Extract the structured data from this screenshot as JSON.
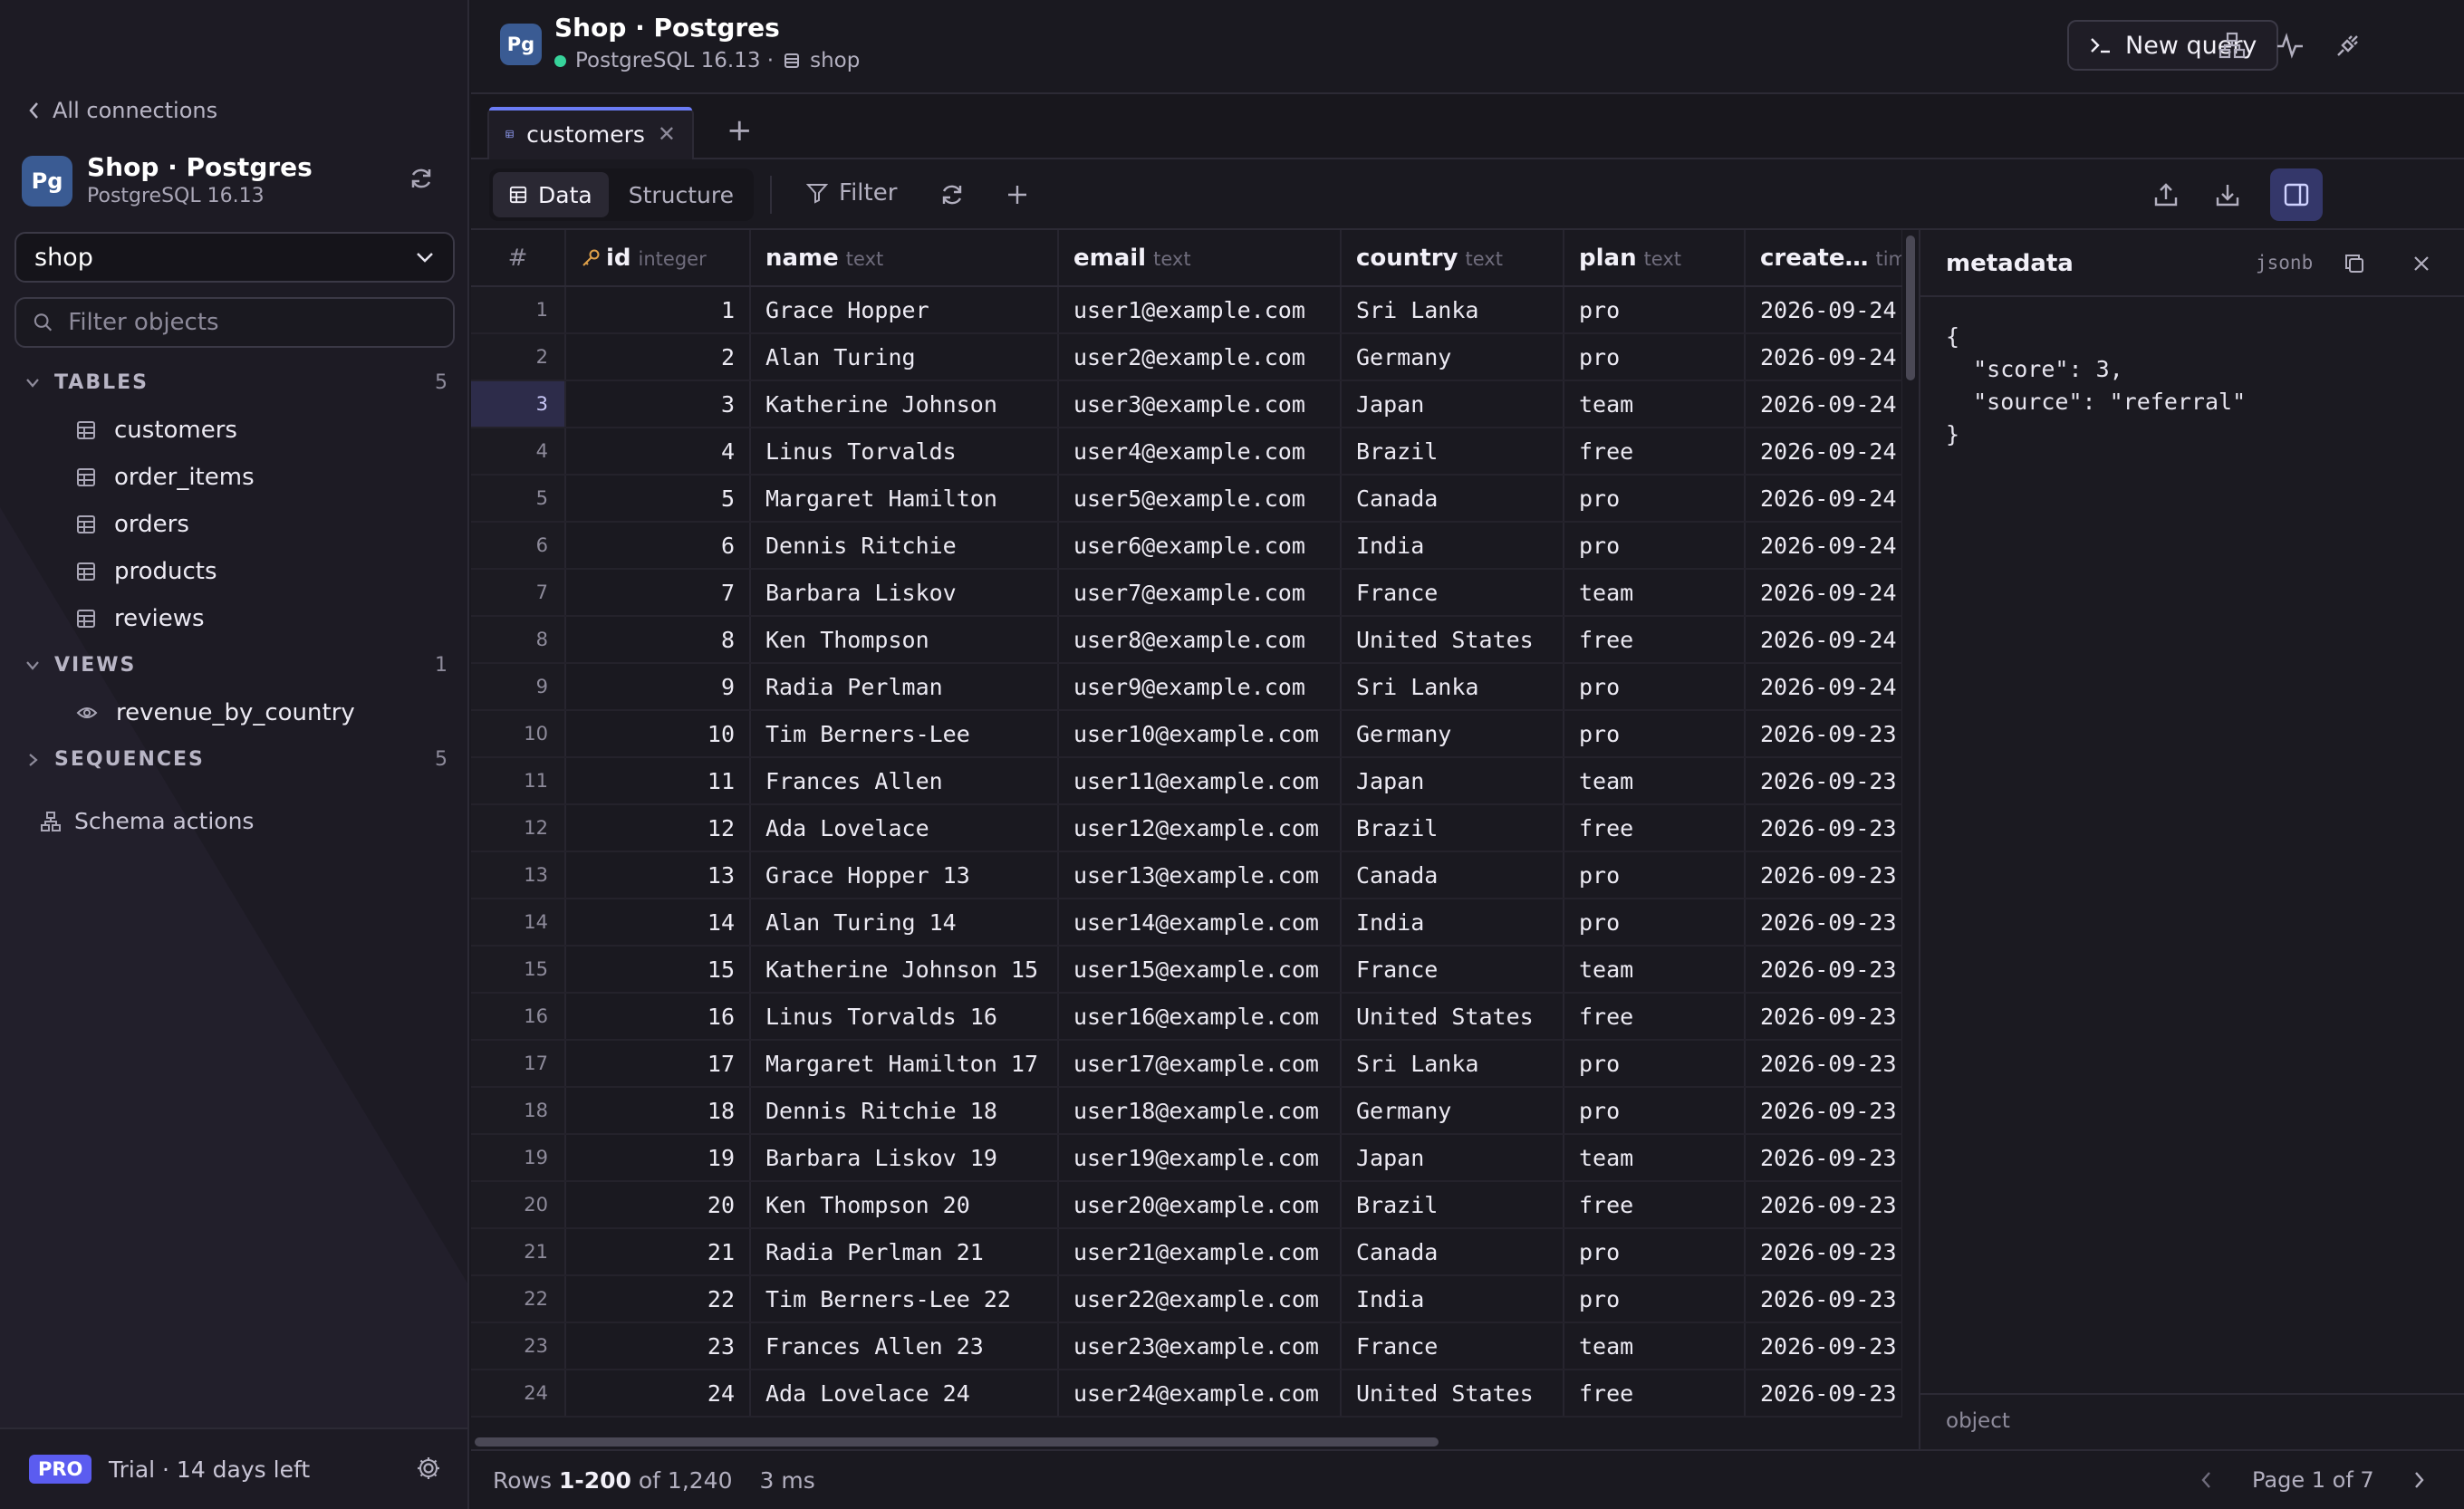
{
  "sidebar": {
    "back_label": "All connections",
    "connection": {
      "badge": "Pg",
      "name": "Shop · Postgres",
      "version": "PostgreSQL 16.13"
    },
    "database_select": "shop",
    "filter_placeholder": "Filter objects",
    "tables": {
      "label": "TABLES",
      "count": "5",
      "items": [
        "customers",
        "order_items",
        "orders",
        "products",
        "reviews"
      ]
    },
    "views": {
      "label": "VIEWS",
      "count": "1",
      "items": [
        "revenue_by_country"
      ]
    },
    "sequences": {
      "label": "SEQUENCES",
      "count": "5"
    },
    "schema_actions": "Schema actions",
    "footer": {
      "badge": "PRO",
      "trial": "Trial · 14 days left"
    }
  },
  "header": {
    "badge": "Pg",
    "title": "Shop · Postgres",
    "status_color": "#37d39b",
    "engine": "PostgreSQL 16.13 ·",
    "database": "shop",
    "new_query": "New query"
  },
  "tabs": [
    {
      "label": "customers",
      "active": true
    }
  ],
  "toolbar": {
    "data_label": "Data",
    "structure_label": "Structure",
    "filter_label": "Filter"
  },
  "grid": {
    "columns": [
      {
        "name": "#",
        "type": ""
      },
      {
        "name": "id",
        "type": "integer"
      },
      {
        "name": "name",
        "type": "text"
      },
      {
        "name": "email",
        "type": "text"
      },
      {
        "name": "country",
        "type": "text"
      },
      {
        "name": "plan",
        "type": "text"
      },
      {
        "name": "create…",
        "type": "tim"
      }
    ],
    "selected_row": 3,
    "rows": [
      [
        "1",
        "1",
        "Grace Hopper",
        "user1@example.com",
        "Sri Lanka",
        "pro",
        "2026-09-24"
      ],
      [
        "2",
        "2",
        "Alan Turing",
        "user2@example.com",
        "Germany",
        "pro",
        "2026-09-24"
      ],
      [
        "3",
        "3",
        "Katherine Johnson",
        "user3@example.com",
        "Japan",
        "team",
        "2026-09-24"
      ],
      [
        "4",
        "4",
        "Linus Torvalds",
        "user4@example.com",
        "Brazil",
        "free",
        "2026-09-24"
      ],
      [
        "5",
        "5",
        "Margaret Hamilton",
        "user5@example.com",
        "Canada",
        "pro",
        "2026-09-24"
      ],
      [
        "6",
        "6",
        "Dennis Ritchie",
        "user6@example.com",
        "India",
        "pro",
        "2026-09-24"
      ],
      [
        "7",
        "7",
        "Barbara Liskov",
        "user7@example.com",
        "France",
        "team",
        "2026-09-24"
      ],
      [
        "8",
        "8",
        "Ken Thompson",
        "user8@example.com",
        "United States",
        "free",
        "2026-09-24"
      ],
      [
        "9",
        "9",
        "Radia Perlman",
        "user9@example.com",
        "Sri Lanka",
        "pro",
        "2026-09-24"
      ],
      [
        "10",
        "10",
        "Tim Berners-Lee",
        "user10@example.com",
        "Germany",
        "pro",
        "2026-09-23"
      ],
      [
        "11",
        "11",
        "Frances Allen",
        "user11@example.com",
        "Japan",
        "team",
        "2026-09-23"
      ],
      [
        "12",
        "12",
        "Ada Lovelace",
        "user12@example.com",
        "Brazil",
        "free",
        "2026-09-23"
      ],
      [
        "13",
        "13",
        "Grace Hopper 13",
        "user13@example.com",
        "Canada",
        "pro",
        "2026-09-23"
      ],
      [
        "14",
        "14",
        "Alan Turing 14",
        "user14@example.com",
        "India",
        "pro",
        "2026-09-23"
      ],
      [
        "15",
        "15",
        "Katherine Johnson 15",
        "user15@example.com",
        "France",
        "team",
        "2026-09-23"
      ],
      [
        "16",
        "16",
        "Linus Torvalds 16",
        "user16@example.com",
        "United States",
        "free",
        "2026-09-23"
      ],
      [
        "17",
        "17",
        "Margaret Hamilton 17",
        "user17@example.com",
        "Sri Lanka",
        "pro",
        "2026-09-23"
      ],
      [
        "18",
        "18",
        "Dennis Ritchie 18",
        "user18@example.com",
        "Germany",
        "pro",
        "2026-09-23"
      ],
      [
        "19",
        "19",
        "Barbara Liskov 19",
        "user19@example.com",
        "Japan",
        "team",
        "2026-09-23"
      ],
      [
        "20",
        "20",
        "Ken Thompson 20",
        "user20@example.com",
        "Brazil",
        "free",
        "2026-09-23"
      ],
      [
        "21",
        "21",
        "Radia Perlman 21",
        "user21@example.com",
        "Canada",
        "pro",
        "2026-09-23"
      ],
      [
        "22",
        "22",
        "Tim Berners-Lee 22",
        "user22@example.com",
        "India",
        "pro",
        "2026-09-23"
      ],
      [
        "23",
        "23",
        "Frances Allen 23",
        "user23@example.com",
        "France",
        "team",
        "2026-09-23"
      ],
      [
        "24",
        "24",
        "Ada Lovelace 24",
        "user24@example.com",
        "United States",
        "free",
        "2026-09-23"
      ]
    ]
  },
  "detail_panel": {
    "title": "metadata",
    "type": "jsonb",
    "content": "{\n  \"score\": 3,\n  \"source\": \"referral\"\n}",
    "footer": "object"
  },
  "status": {
    "rows_prefix": "Rows ",
    "rows_range": "1-200",
    "rows_suffix": " of 1,240",
    "time": "3 ms",
    "page": "Page 1 of 7"
  }
}
